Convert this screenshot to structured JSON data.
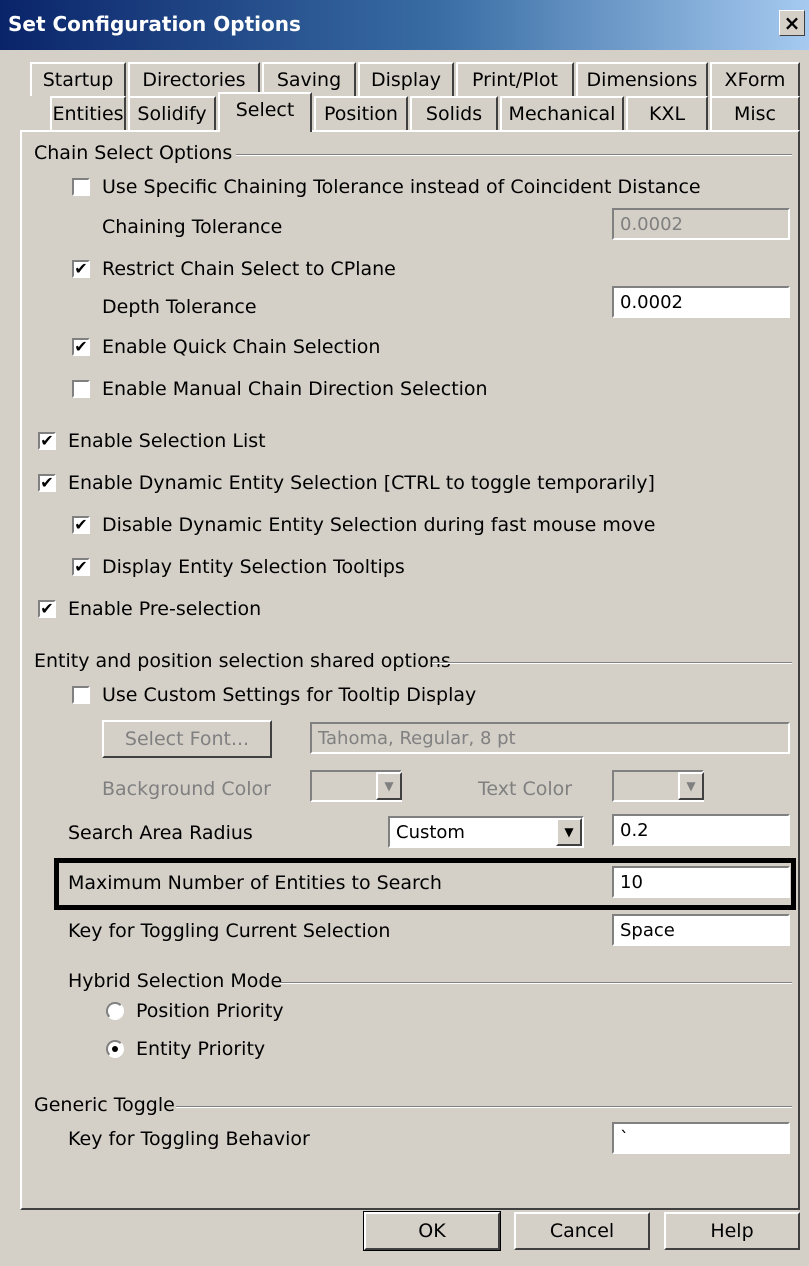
{
  "window": {
    "title": "Set Configuration Options",
    "close_glyph": "×"
  },
  "tabs_row1": [
    "Startup",
    "Directories",
    "Saving",
    "Display",
    "Print/Plot",
    "Dimensions",
    "XForm"
  ],
  "tabs_row2": [
    "Entities",
    "Solidify",
    "Select",
    "Position",
    "Solids",
    "Mechanical",
    "KXL",
    "Misc"
  ],
  "active_tab": "Select",
  "chain": {
    "group_label": "Chain Select Options",
    "use_specific": {
      "label": "Use Specific Chaining Tolerance instead of Coincident Distance",
      "checked": false
    },
    "chaining_tolerance": {
      "label": "Chaining Tolerance",
      "value": "0.0002"
    },
    "restrict_cplane": {
      "label": "Restrict Chain Select to CPlane",
      "checked": true
    },
    "depth_tolerance": {
      "label": "Depth Tolerance",
      "value": "0.0002"
    },
    "quick_chain": {
      "label": "Enable Quick Chain Selection",
      "checked": true
    },
    "manual_direction": {
      "label": "Enable Manual Chain Direction Selection",
      "checked": false
    }
  },
  "selection_list": {
    "label": "Enable Selection List",
    "checked": true
  },
  "dynamic_selection": {
    "label": "Enable Dynamic Entity Selection [CTRL to toggle temporarily]",
    "checked": true
  },
  "disable_fast_move": {
    "label": "Disable Dynamic Entity Selection during fast mouse move",
    "checked": true
  },
  "tooltips": {
    "label": "Display Entity Selection Tooltips",
    "checked": true
  },
  "preselection": {
    "label": "Enable Pre-selection",
    "checked": true
  },
  "shared": {
    "group_label": "Entity and position selection shared options",
    "custom_tooltip": {
      "label": "Use Custom Settings for Tooltip Display",
      "checked": false
    },
    "select_font_button": "Select Font...",
    "font_value": "Tahoma, Regular, 8 pt",
    "background_color_label": "Background Color",
    "text_color_label": "Text Color",
    "search_radius_label": "Search Area Radius",
    "search_radius_mode": "Custom",
    "search_radius_value": "0.2",
    "max_entities_label": "Maximum Number of Entities to Search",
    "max_entities_value": "10",
    "toggle_key_label": "Key for Toggling Current Selection",
    "toggle_key_value": "Space",
    "hybrid_group_label": "Hybrid Selection Mode",
    "position_priority": {
      "label": "Position Priority",
      "selected": false
    },
    "entity_priority": {
      "label": "Entity Priority",
      "selected": true
    }
  },
  "generic": {
    "group_label": "Generic Toggle",
    "toggle_behavior_label": "Key for Toggling Behavior",
    "toggle_behavior_value": "`"
  },
  "buttons": {
    "ok": "OK",
    "cancel": "Cancel",
    "help": "Help"
  },
  "check_glyph": "✔",
  "dropdown_glyph": "▼"
}
